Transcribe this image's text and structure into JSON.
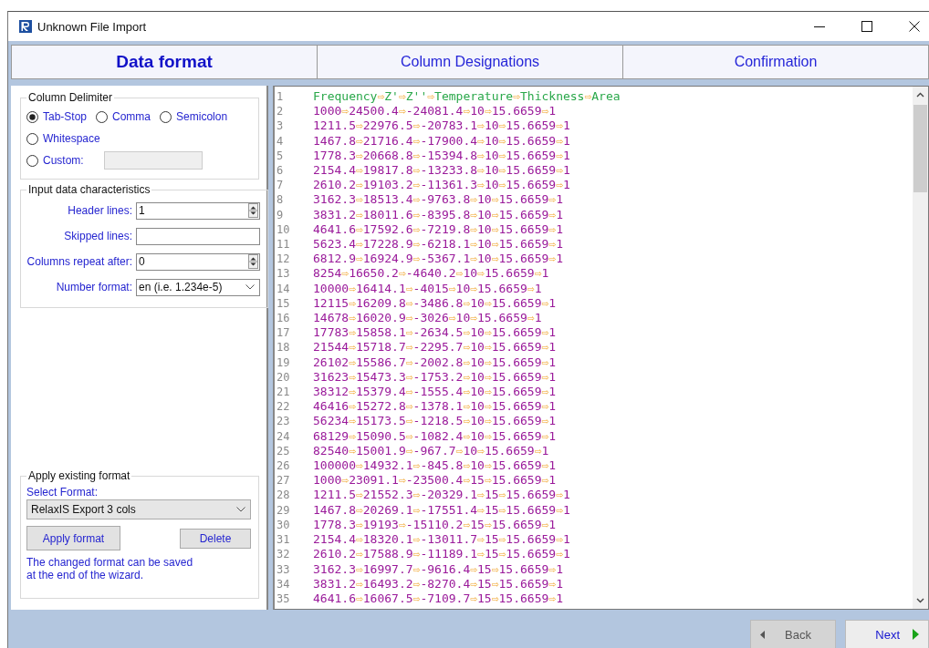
{
  "window": {
    "title": "Unknown File Import"
  },
  "tabs": [
    {
      "label": "Data format",
      "selected": true
    },
    {
      "label": "Column Designations",
      "selected": false
    },
    {
      "label": "Confirmation",
      "selected": false
    }
  ],
  "column_delimiter": {
    "title": "Column Delimiter",
    "options": [
      {
        "label": "Tab-Stop",
        "selected": true
      },
      {
        "label": "Comma",
        "selected": false
      },
      {
        "label": "Semicolon",
        "selected": false
      },
      {
        "label": "Whitespace",
        "selected": false
      },
      {
        "label": "Custom:",
        "selected": false
      }
    ]
  },
  "input_characteristics": {
    "title": "Input data characteristics",
    "fields": [
      {
        "kind": "spin",
        "label": "Header lines:",
        "value": "1"
      },
      {
        "kind": "text",
        "label": "Skipped lines:"
      },
      {
        "kind": "spin",
        "label": "Columns repeat after:",
        "value": "0"
      },
      {
        "kind": "select",
        "label": "Number format:",
        "value": "en (i.e. 1.234e-5)"
      }
    ]
  },
  "existing_format": {
    "title": "Apply existing format",
    "select_label": "Select Format:",
    "selected_format": "RelaxIS Export 3 cols",
    "apply_button": "Apply format",
    "delete_button": "Delete",
    "note": "The changed format can be saved at the end of the wizard."
  },
  "preview": {
    "lines": [
      {
        "number": "1",
        "kind": "header",
        "text": "Frequency⇨Z'⇨Z''⇨Temperature⇨Thickness⇨Area"
      },
      {
        "number": "2",
        "kind": "data",
        "text": "1000⇨24500.4⇨-24081.4⇨10⇨15.6659⇨1"
      },
      {
        "number": "3",
        "kind": "data",
        "text": "1211.5⇨22976.5⇨-20783.1⇨10⇨15.6659⇨1"
      },
      {
        "number": "4",
        "kind": "data",
        "text": "1467.8⇨21716.4⇨-17900.4⇨10⇨15.6659⇨1"
      },
      {
        "number": "5",
        "kind": "data",
        "text": "1778.3⇨20668.8⇨-15394.8⇨10⇨15.6659⇨1"
      },
      {
        "number": "6",
        "kind": "data",
        "text": "2154.4⇨19817.8⇨-13233.8⇨10⇨15.6659⇨1"
      },
      {
        "number": "7",
        "kind": "data",
        "text": "2610.2⇨19103.2⇨-11361.3⇨10⇨15.6659⇨1"
      },
      {
        "number": "8",
        "kind": "data",
        "text": "3162.3⇨18513.4⇨-9763.8⇨10⇨15.6659⇨1"
      },
      {
        "number": "9",
        "kind": "data",
        "text": "3831.2⇨18011.6⇨-8395.8⇨10⇨15.6659⇨1"
      },
      {
        "number": "10",
        "kind": "data",
        "text": "4641.6⇨17592.6⇨-7219.8⇨10⇨15.6659⇨1"
      },
      {
        "number": "11",
        "kind": "data",
        "text": "5623.4⇨17228.9⇨-6218.1⇨10⇨15.6659⇨1"
      },
      {
        "number": "12",
        "kind": "data",
        "text": "6812.9⇨16924.9⇨-5367.1⇨10⇨15.6659⇨1"
      },
      {
        "number": "13",
        "kind": "data",
        "text": "8254⇨16650.2⇨-4640.2⇨10⇨15.6659⇨1"
      },
      {
        "number": "14",
        "kind": "data",
        "text": "10000⇨16414.1⇨-4015⇨10⇨15.6659⇨1"
      },
      {
        "number": "15",
        "kind": "data",
        "text": "12115⇨16209.8⇨-3486.8⇨10⇨15.6659⇨1"
      },
      {
        "number": "16",
        "kind": "data",
        "text": "14678⇨16020.9⇨-3026⇨10⇨15.6659⇨1"
      },
      {
        "number": "17",
        "kind": "data",
        "text": "17783⇨15858.1⇨-2634.5⇨10⇨15.6659⇨1"
      },
      {
        "number": "18",
        "kind": "data",
        "text": "21544⇨15718.7⇨-2295.7⇨10⇨15.6659⇨1"
      },
      {
        "number": "19",
        "kind": "data",
        "text": "26102⇨15586.7⇨-2002.8⇨10⇨15.6659⇨1"
      },
      {
        "number": "20",
        "kind": "data",
        "text": "31623⇨15473.3⇨-1753.2⇨10⇨15.6659⇨1"
      },
      {
        "number": "21",
        "kind": "data",
        "text": "38312⇨15379.4⇨-1555.4⇨10⇨15.6659⇨1"
      },
      {
        "number": "22",
        "kind": "data",
        "text": "46416⇨15272.8⇨-1378.1⇨10⇨15.6659⇨1"
      },
      {
        "number": "23",
        "kind": "data",
        "text": "56234⇨15173.5⇨-1218.5⇨10⇨15.6659⇨1"
      },
      {
        "number": "24",
        "kind": "data",
        "text": "68129⇨15090.5⇨-1082.4⇨10⇨15.6659⇨1"
      },
      {
        "number": "25",
        "kind": "data",
        "text": "82540⇨15001.9⇨-967.7⇨10⇨15.6659⇨1"
      },
      {
        "number": "26",
        "kind": "data",
        "text": "100000⇨14932.1⇨-845.8⇨10⇨15.6659⇨1"
      },
      {
        "number": "27",
        "kind": "data",
        "text": "1000⇨23091.1⇨-23500.4⇨15⇨15.6659⇨1"
      },
      {
        "number": "28",
        "kind": "data",
        "text": "1211.5⇨21552.3⇨-20329.1⇨15⇨15.6659⇨1"
      },
      {
        "number": "29",
        "kind": "data",
        "text": "1467.8⇨20269.1⇨-17551.4⇨15⇨15.6659⇨1"
      },
      {
        "number": "30",
        "kind": "data",
        "text": "1778.3⇨19193⇨-15110.2⇨15⇨15.6659⇨1"
      },
      {
        "number": "31",
        "kind": "data",
        "text": "2154.4⇨18320.1⇨-13011.7⇨15⇨15.6659⇨1"
      },
      {
        "number": "32",
        "kind": "data",
        "text": "2610.2⇨17588.9⇨-11189.1⇨15⇨15.6659⇨1"
      },
      {
        "number": "33",
        "kind": "data",
        "text": "3162.3⇨16997.7⇨-9616.4⇨15⇨15.6659⇨1"
      },
      {
        "number": "34",
        "kind": "data",
        "text": "3831.2⇨16493.2⇨-8270.4⇨15⇨15.6659⇨1"
      },
      {
        "number": "35",
        "kind": "data",
        "text": "4641.6⇨16067.5⇨-7109.7⇨15⇨15.6659⇨1"
      }
    ]
  },
  "navigation": {
    "back": "Back",
    "next": "Next"
  }
}
